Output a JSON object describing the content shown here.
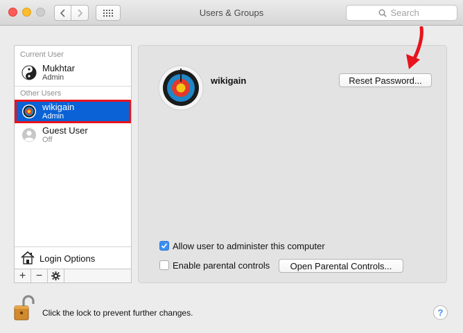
{
  "window": {
    "title": "Users & Groups",
    "search_placeholder": "Search"
  },
  "sidebar": {
    "current_user_label": "Current User",
    "other_users_label": "Other Users",
    "users": [
      {
        "name": "Mukhtar",
        "role": "Admin",
        "avatar": "yin-yang-icon"
      },
      {
        "name": "wikigain",
        "role": "Admin",
        "avatar": "target-icon",
        "selected": true
      },
      {
        "name": "Guest User",
        "role": "Off",
        "avatar": "person-silhouette-icon"
      }
    ],
    "login_options_label": "Login Options",
    "toolbar": {
      "add": "+",
      "remove": "−"
    }
  },
  "detail": {
    "user_name": "wikigain",
    "reset_password_label": "Reset Password...",
    "allow_admin_label": "Allow user to administer this computer",
    "allow_admin_checked": true,
    "parental_controls_label": "Enable parental controls",
    "parental_controls_checked": false,
    "open_parental_label": "Open Parental Controls..."
  },
  "footer": {
    "lock_text": "Click the lock to prevent further changes.",
    "help_label": "?"
  },
  "colors": {
    "selection": "#0a62d6",
    "highlight_border": "#e8131c",
    "checkbox_on": "#3b8ff0",
    "annotation_arrow": "#e8131c"
  }
}
